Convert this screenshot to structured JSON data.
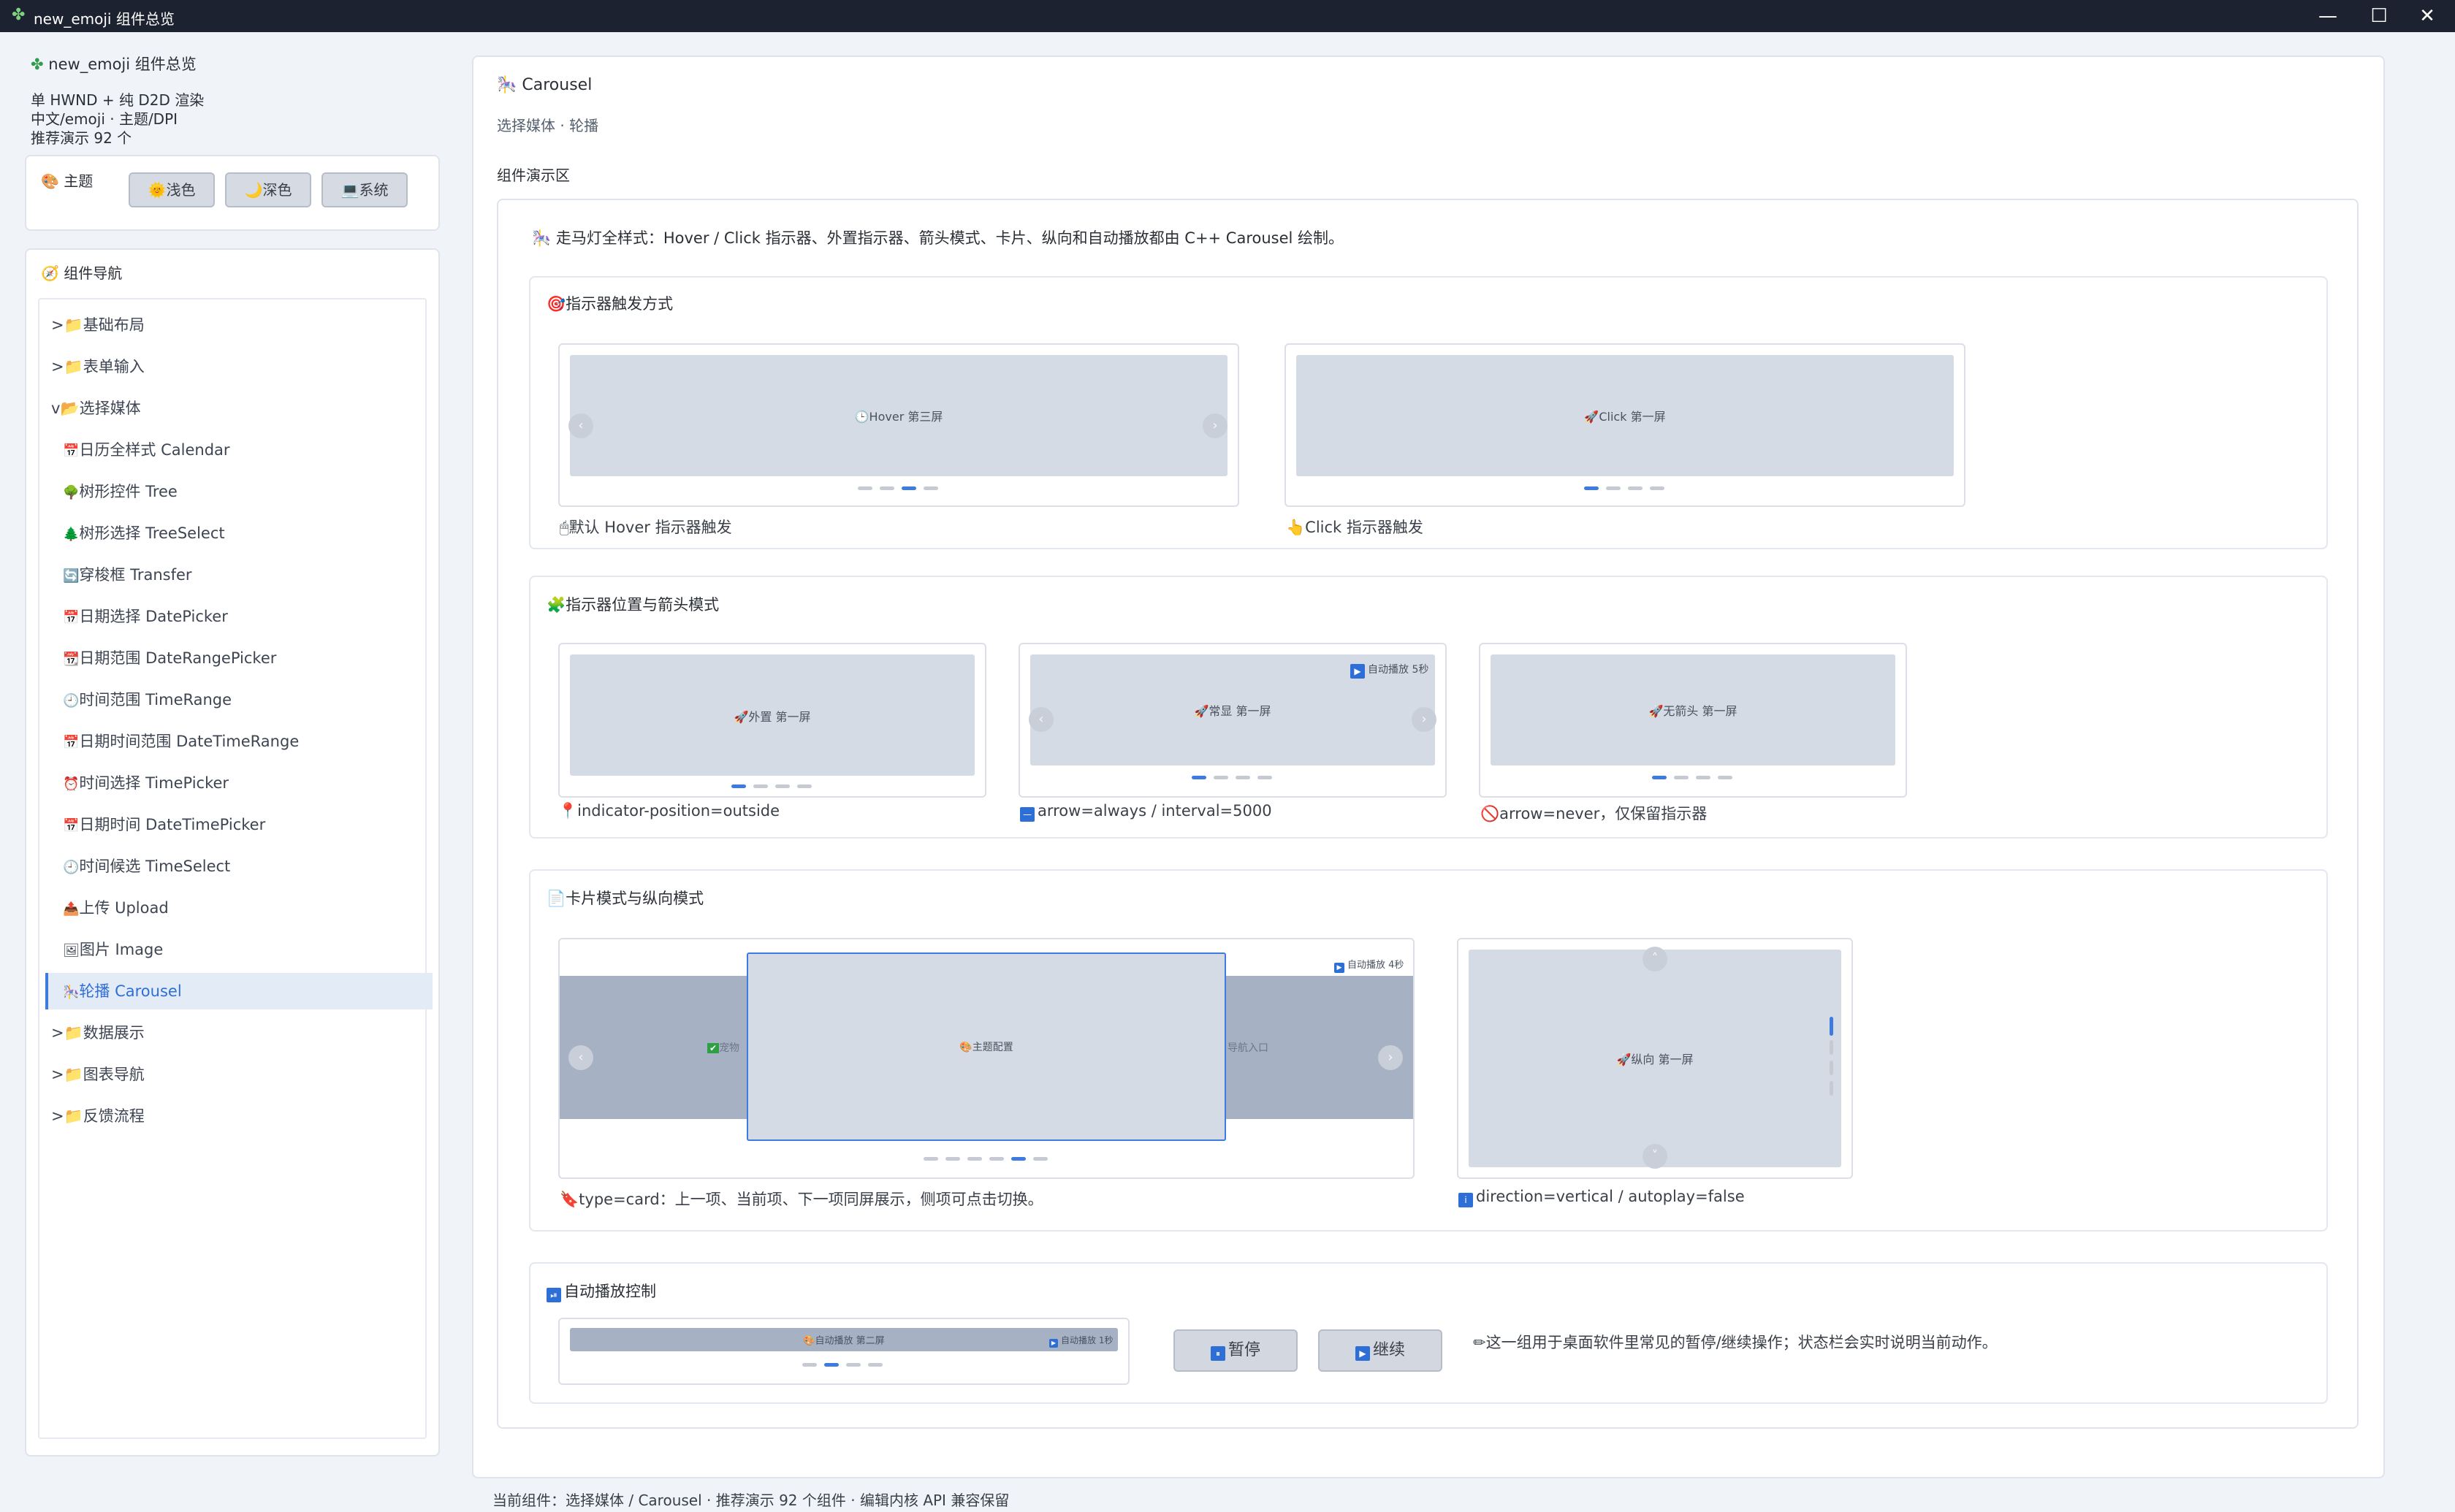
{
  "window": {
    "title": "new_emoji 组件总览"
  },
  "sidebar": {
    "app_title": "new_emoji 组件总览",
    "info_lines": [
      "单 HWND + 纯 D2D 渲染",
      "中文/emoji · 主题/DPI",
      "推荐演示 92 个"
    ],
    "theme": {
      "label": "主题",
      "buttons": [
        "浅色",
        "深色",
        "系统"
      ]
    },
    "nav": {
      "title": "组件导航",
      "groups_before": [
        "基础布局",
        "表单输入"
      ],
      "open_group": "选择媒体",
      "children": [
        {
          "label": "日历全样式 Calendar",
          "icon": "calendar-icon",
          "glyph": "📅"
        },
        {
          "label": "树形控件 Tree",
          "icon": "tree-icon",
          "glyph": "🌳"
        },
        {
          "label": "树形选择 TreeSelect",
          "icon": "pine-icon",
          "glyph": "🌲"
        },
        {
          "label": "穿梭框 Transfer",
          "icon": "transfer-icon",
          "glyph": "🔄"
        },
        {
          "label": "日期选择 DatePicker",
          "icon": "calendar-icon",
          "glyph": "📅"
        },
        {
          "label": "日期范围 DateRangePicker",
          "icon": "calendar-icon",
          "glyph": "📆"
        },
        {
          "label": "时间范围 TimeRange",
          "icon": "clock-icon",
          "glyph": "🕘"
        },
        {
          "label": "日期时间范围 DateTimeRange",
          "icon": "calendar-icon",
          "glyph": "📅"
        },
        {
          "label": "时间选择 TimePicker",
          "icon": "alarm-clock-icon",
          "glyph": "⏰"
        },
        {
          "label": "日期时间 DateTimePicker",
          "icon": "calendar-icon",
          "glyph": "📅"
        },
        {
          "label": "时间候选 TimeSelect",
          "icon": "clock-icon",
          "glyph": "🕘"
        },
        {
          "label": "上传 Upload",
          "icon": "upload-icon",
          "glyph": "📤"
        },
        {
          "label": "图片 Image",
          "icon": "image-icon",
          "glyph": "🖼"
        },
        {
          "label": "轮播 Carousel",
          "icon": "carousel-icon",
          "glyph": "🎠"
        }
      ],
      "groups_after": [
        "数据展示",
        "图表导航",
        "反馈流程"
      ]
    }
  },
  "main": {
    "title": "Carousel",
    "subtitle": "选择媒体 · 轮播",
    "demo_area_label": "组件演示区",
    "intro": "走马灯全样式：Hover / Click 指示器、外置指示器、箭头模式、卡片、纵向和自动播放都由 C++ Carousel 绘制。",
    "sec1": {
      "title": "指示器触发方式",
      "demo_a": {
        "slide": "Hover 第三屏",
        "caption": "默认 Hover 指示器触发"
      },
      "demo_b": {
        "slide": "Click 第一屏",
        "caption": "Click 指示器触发"
      }
    },
    "sec2": {
      "title": "指示器位置与箭头模式",
      "demo_a": {
        "slide": "外置 第一屏",
        "caption": "indicator-position=outside"
      },
      "demo_b": {
        "slide": "常显 第一屏",
        "badge": "自动播放 5秒",
        "caption": "arrow=always / interval=5000"
      },
      "demo_c": {
        "slide": "无箭头 第一屏",
        "caption": "arrow=never，仅保留指示器"
      }
    },
    "sec3": {
      "title": "卡片模式与纵向模式",
      "card_demo": {
        "slide": "主题配置",
        "left_peek": "宠物",
        "right_peek": "导航入口",
        "badge": "自动播放 4秒",
        "caption": "type=card：上一项、当前项、下一项同屏展示，侧项可点击切换。"
      },
      "vertical_demo": {
        "slide": "纵向 第一屏",
        "caption": "direction=vertical / autoplay=false"
      }
    },
    "sec4": {
      "title": "自动播放控制",
      "mini": {
        "slide": "自动播放 第二屏",
        "badge": "自动播放 1秒"
      },
      "pause_label": "暂停",
      "resume_label": "继续",
      "note": "这一组用于桌面软件里常见的暂停/继续操作；状态栏会实时说明当前动作。"
    }
  },
  "statusbar": {
    "text": "当前组件：选择媒体 / Carousel · 推荐演示 92 个组件 · 编辑内核 API 兼容保留"
  },
  "colors": {
    "accent": "#3d7be0",
    "titlebar": "#1d2230",
    "selected_bg": "#e3ebf7",
    "slide_bg": "#d5dbe4"
  }
}
